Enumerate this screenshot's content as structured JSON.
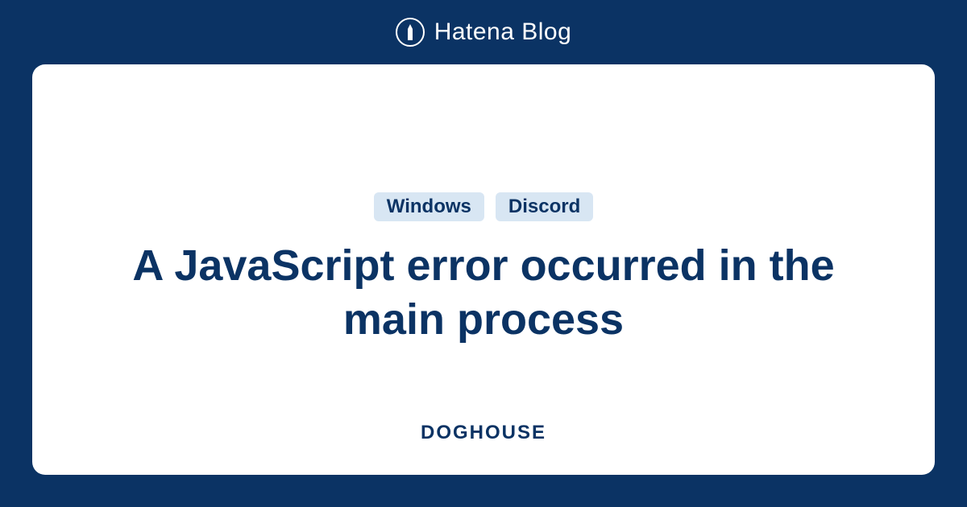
{
  "header": {
    "brand": "Hatena Blog"
  },
  "card": {
    "tags": [
      "Windows",
      "Discord"
    ],
    "title": "A JavaScript error occurred in the main process",
    "author": "DOGHOUSE"
  }
}
